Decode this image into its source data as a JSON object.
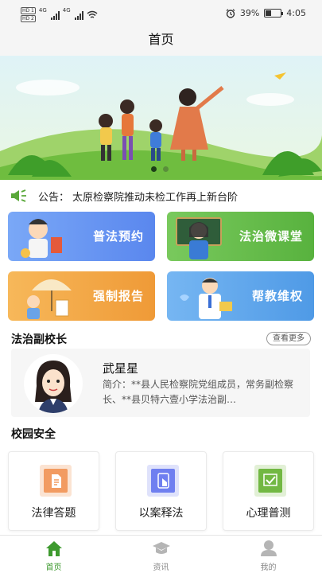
{
  "status_bar": {
    "sim1": "HD 1",
    "sim2": "HD 2",
    "signal1": "4G",
    "signal2": "4G",
    "battery_percent": "39%",
    "time": "4:05"
  },
  "header": {
    "title": "首页"
  },
  "banner": {
    "slides": 2,
    "active_slide": 1
  },
  "notice": {
    "label": "公告：",
    "text": "太原检察院推动未检工作再上新台阶"
  },
  "cards": [
    {
      "label": "普法预约",
      "color": "#5f8ff2"
    },
    {
      "label": "法治微课堂",
      "color": "#62b84a"
    },
    {
      "label": "强制报告",
      "color": "#f2a544"
    },
    {
      "label": "帮教维权",
      "color": "#5aa4ea"
    }
  ],
  "vice_principal": {
    "heading": "法治副校长",
    "more_label": "查看更多",
    "name": "武星星",
    "intro": "简介：**县人民检察院党组成员，常务副检察长、**县贝特六壹小学法治副…"
  },
  "campus_safety": {
    "heading": "校园安全",
    "items": [
      {
        "label": "法律答题",
        "icon": "document-icon",
        "color": "#f29b61"
      },
      {
        "label": "以案释法",
        "icon": "touch-icon",
        "color": "#6f7ff0"
      },
      {
        "label": "心理普测",
        "icon": "check-icon",
        "color": "#72b843"
      }
    ]
  },
  "tab_bar": {
    "tabs": [
      {
        "label": "首页",
        "icon": "home-icon",
        "active": true
      },
      {
        "label": "资讯",
        "icon": "graduation-cap-icon",
        "active": false
      },
      {
        "label": "我的",
        "icon": "user-icon",
        "active": false
      }
    ],
    "active_color": "#3e9a2f"
  }
}
